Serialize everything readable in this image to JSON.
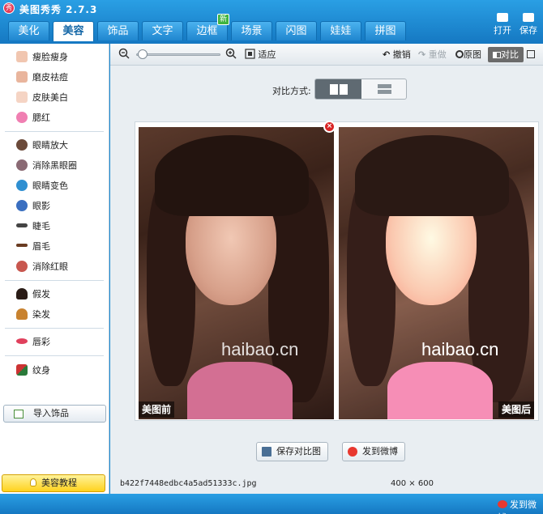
{
  "app": {
    "title": "美图秀秀 2.7.3",
    "logo_char": "秀"
  },
  "tabs": [
    {
      "label": "美化"
    },
    {
      "label": "美容",
      "active": true
    },
    {
      "label": "饰品"
    },
    {
      "label": "文字"
    },
    {
      "label": "边框",
      "badge": "新"
    },
    {
      "label": "场景"
    },
    {
      "label": "闪图"
    },
    {
      "label": "娃娃"
    },
    {
      "label": "拼图"
    }
  ],
  "top_actions": {
    "open": "打开",
    "save": "保存"
  },
  "sidebar": {
    "groups": [
      [
        {
          "label": "瘦脸瘦身",
          "icon": "face-slim-icon"
        },
        {
          "label": "磨皮祛痘",
          "icon": "skin-smooth-icon"
        },
        {
          "label": "皮肤美白",
          "icon": "skin-whiten-icon"
        },
        {
          "label": "腮红",
          "icon": "blush-icon"
        }
      ],
      [
        {
          "label": "眼睛放大",
          "icon": "eye-enlarge-icon"
        },
        {
          "label": "消除黑眼圈",
          "icon": "dark-circle-icon"
        },
        {
          "label": "眼睛变色",
          "icon": "eye-color-icon"
        },
        {
          "label": "眼影",
          "icon": "eyeshadow-icon"
        },
        {
          "label": "睫毛",
          "icon": "eyelash-icon"
        },
        {
          "label": "眉毛",
          "icon": "eyebrow-icon"
        },
        {
          "label": "消除红眼",
          "icon": "red-eye-icon"
        }
      ],
      [
        {
          "label": "假发",
          "icon": "wig-icon"
        },
        {
          "label": "染发",
          "icon": "hair-dye-icon"
        }
      ],
      [
        {
          "label": "唇彩",
          "icon": "lip-color-icon"
        }
      ],
      [
        {
          "label": "纹身",
          "icon": "tattoo-icon"
        }
      ]
    ],
    "import_label": "导入饰品",
    "tutorial_label": "美容教程"
  },
  "toolbar": {
    "fit_label": "适应",
    "undo_label": "撤销",
    "redo_label": "重做",
    "original_label": "原图",
    "compare_label": "对比",
    "zoom_level": 0.02
  },
  "compare_mode": {
    "label": "对比方式:"
  },
  "photos": {
    "before_label": "美图前",
    "after_label": "美图后",
    "watermark": "haibao.cn"
  },
  "actions": {
    "save_compare": "保存对比图",
    "send_weibo": "发到微博"
  },
  "status": {
    "filename": "b422f7448edbc4a5ad51333c.jpg",
    "width": "400",
    "times": "×",
    "height": "600"
  },
  "bottom": {
    "weibo": "发到微博"
  },
  "colors": {
    "accent": "#1a8ad3",
    "compare_active": "#6b6b6b",
    "badge": "#3fb43f"
  }
}
